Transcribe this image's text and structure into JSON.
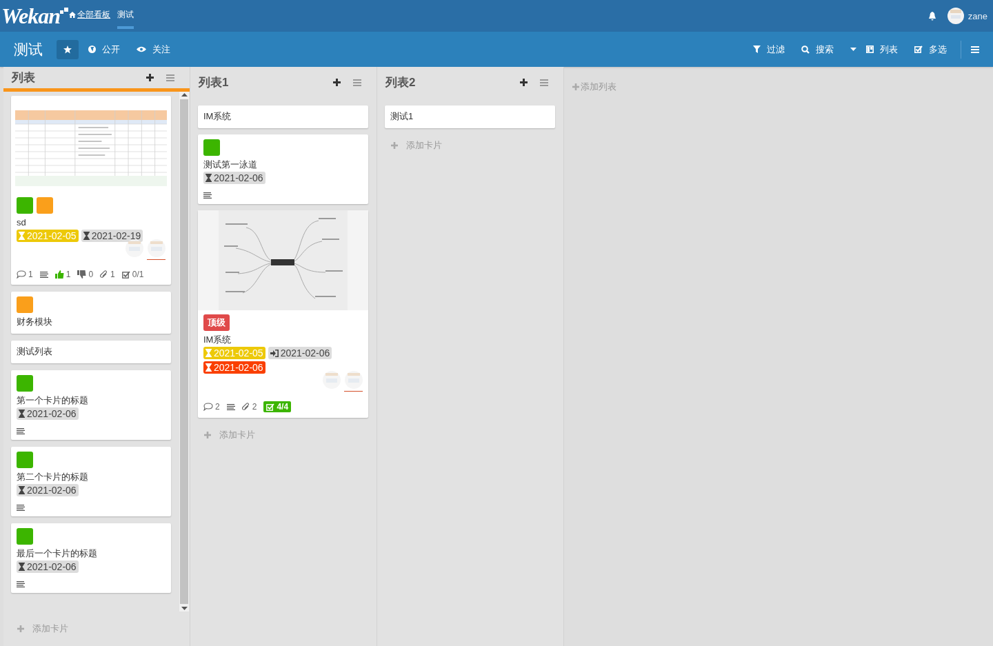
{
  "header": {
    "logo": "Wekan",
    "breadcrumbs": [
      {
        "label": "全部看板",
        "selected": false
      },
      {
        "label": "测试",
        "selected": true
      }
    ],
    "user": "zane"
  },
  "board": {
    "title": "测试",
    "starred": true,
    "visibility": "公开",
    "watch": "关注",
    "tools": [
      {
        "kind": "filter",
        "label": "过滤"
      },
      {
        "kind": "search",
        "label": "搜索"
      },
      {
        "kind": "view",
        "label": "列表"
      },
      {
        "kind": "multiselect",
        "label": "多选"
      }
    ]
  },
  "lists": [
    {
      "title": "列表",
      "selected": true,
      "scrollable": true,
      "add_card": "添加卡片",
      "cards": [
        {
          "cover": {
            "kind": "sheet"
          },
          "labels": [
            {
              "color": "#3cb500"
            },
            {
              "color": "#fa9f1b"
            }
          ],
          "title": "sd",
          "dates": [
            {
              "kind": "start",
              "color": "#edc909",
              "text": "2021-02-05"
            },
            {
              "kind": "due",
              "color": "#dcdcdc",
              "text": "2021-02-19"
            }
          ],
          "avatars": [
            {
              "kind": "picture"
            },
            {
              "kind": "picture"
            }
          ],
          "badges": [
            {
              "kind": "comment",
              "text": "1"
            },
            {
              "kind": "description"
            },
            {
              "kind": "like",
              "text": "1"
            },
            {
              "kind": "dislike",
              "text": "0"
            },
            {
              "kind": "attachment",
              "text": "1"
            },
            {
              "kind": "checklist",
              "text": "0/1",
              "complete": false
            }
          ]
        },
        {
          "labels": [
            {
              "color": "#fa9f1b"
            }
          ],
          "title": "财务模块"
        },
        {
          "title": "测试列表"
        },
        {
          "labels": [
            {
              "color": "#3cb500"
            }
          ],
          "title": "第一个卡片的标题",
          "dates": [
            {
              "kind": "due",
              "color": "#dcdcdc",
              "text": "2021-02-06"
            }
          ],
          "badges": [
            {
              "kind": "description"
            }
          ]
        },
        {
          "labels": [
            {
              "color": "#3cb500"
            }
          ],
          "title": "第二个卡片的标题",
          "dates": [
            {
              "kind": "due",
              "color": "#dcdcdc",
              "text": "2021-02-06"
            }
          ],
          "badges": [
            {
              "kind": "description"
            }
          ]
        },
        {
          "labels": [
            {
              "color": "#3cb500"
            }
          ],
          "title": "最后一个卡片的标题",
          "dates": [
            {
              "kind": "due",
              "color": "#dcdcdc",
              "text": "2021-02-06"
            }
          ],
          "badges": [
            {
              "kind": "description"
            }
          ]
        }
      ]
    },
    {
      "title": "列表1",
      "selected": false,
      "scrollable": false,
      "add_card": "添加卡片",
      "cards": [
        {
          "title": "IM系统"
        },
        {
          "labels": [
            {
              "color": "#3cb500"
            }
          ],
          "title": "测试第一泳道",
          "dates": [
            {
              "kind": "due",
              "color": "#dcdcdc",
              "text": "2021-02-06"
            }
          ],
          "badges": [
            {
              "kind": "description"
            }
          ]
        },
        {
          "cover": {
            "kind": "mindmap"
          },
          "labels": [
            {
              "color": "#e04a4a",
              "text": "顶级"
            }
          ],
          "title": "IM系统",
          "dates": [
            {
              "kind": "start",
              "color": "#edc909",
              "text": "2021-02-05"
            },
            {
              "kind": "received",
              "color": "#dcdcdc",
              "text": "2021-02-06"
            },
            {
              "kind": "due",
              "color": "#fa3f00",
              "text": "2021-02-06"
            }
          ],
          "avatars": [
            {
              "kind": "picture"
            },
            {
              "kind": "picture"
            }
          ],
          "badges": [
            {
              "kind": "comment",
              "text": "2"
            },
            {
              "kind": "description"
            },
            {
              "kind": "attachment",
              "text": "2"
            },
            {
              "kind": "checklist",
              "text": "4/4",
              "complete": true
            }
          ]
        }
      ]
    },
    {
      "title": "列表2",
      "selected": false,
      "scrollable": false,
      "add_card": "添加卡片",
      "cards": [
        {
          "title": "测试1"
        }
      ]
    }
  ],
  "add_list": "添加列表"
}
